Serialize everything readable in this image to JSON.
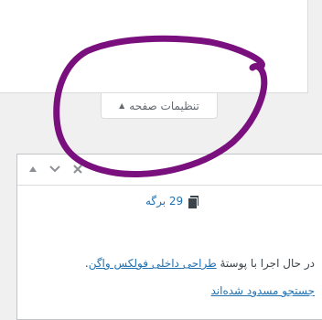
{
  "screen_options": {
    "label": "تنظیمات صفحه"
  },
  "widget": {
    "controls": {
      "up": "▲",
      "down": "⌄",
      "close": "✕"
    },
    "pages_count": "29 برگه",
    "trunc_right": "ه",
    "theme_prefix": "در حال اجرا با پوستهٔ",
    "theme_name": "طراحی داخلی فولکس واگن",
    "theme_suffix": ".",
    "blocked_link": "جستجو مسدود شده‌اند"
  },
  "colors": {
    "link": "#2271b1",
    "annotation": "#7a0f7e"
  }
}
